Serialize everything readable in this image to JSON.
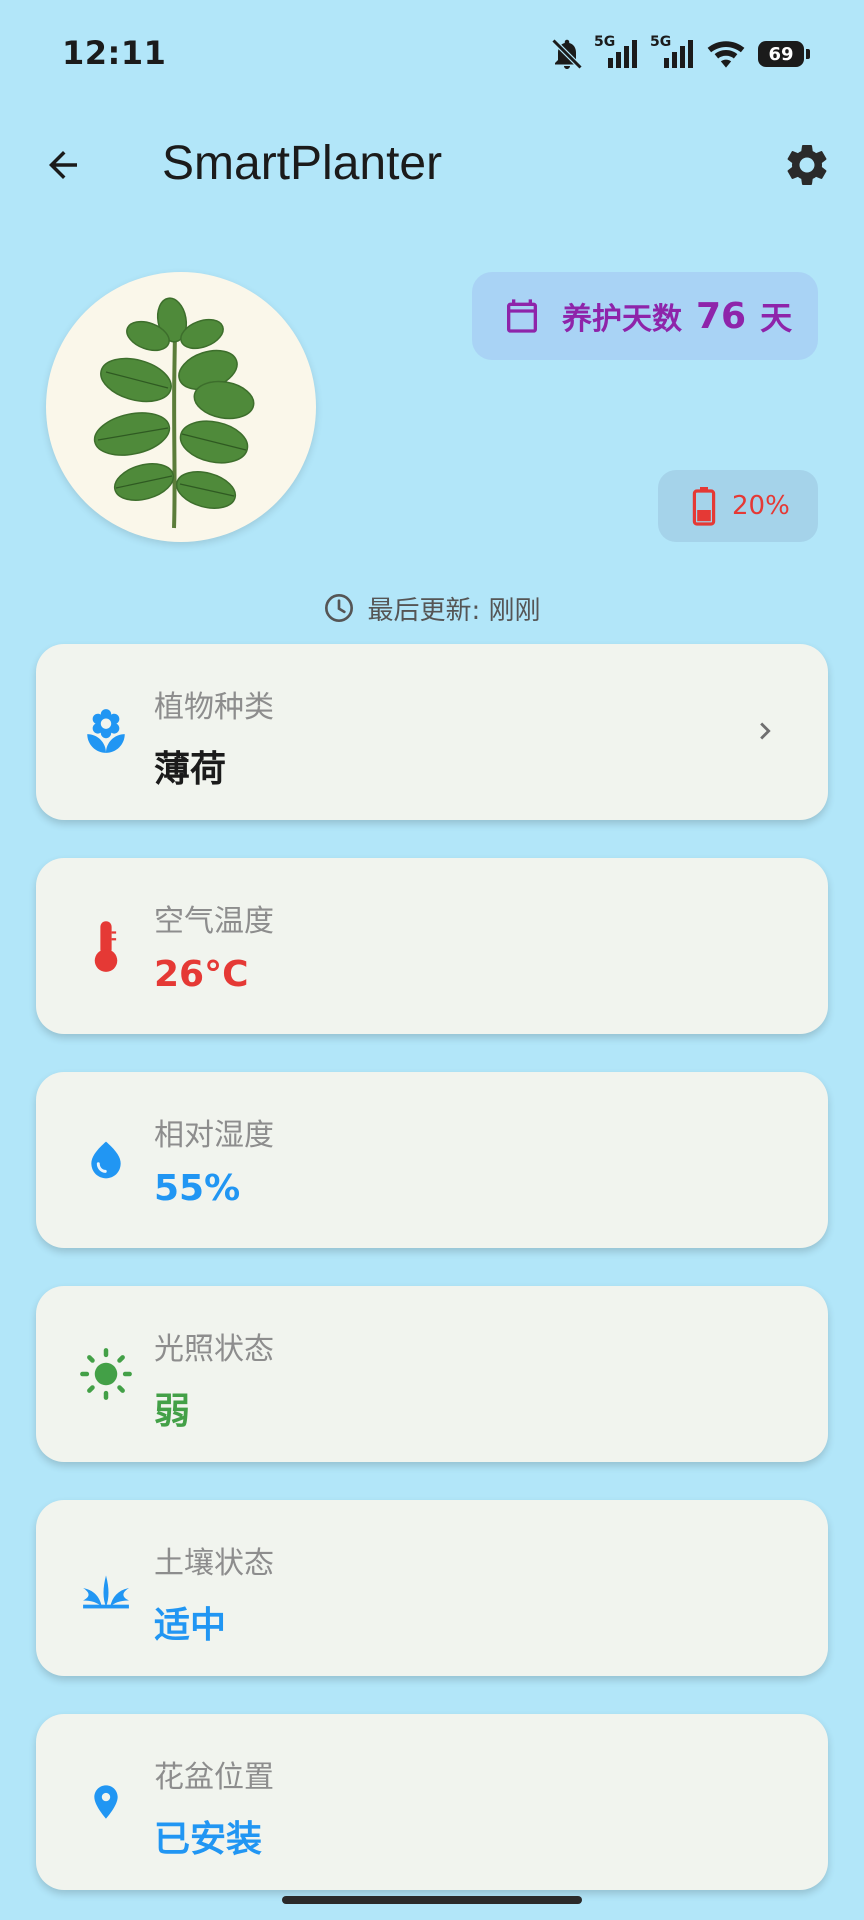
{
  "status_bar": {
    "time": "12:11",
    "network_1": "5G",
    "network_2": "5G",
    "battery": "69"
  },
  "app_bar": {
    "title": "SmartPlanter",
    "back_icon": "arrow-back-icon",
    "settings_icon": "gear-icon"
  },
  "care_days": {
    "label": "养护天数",
    "value": "76",
    "unit": "天",
    "icon": "calendar-icon",
    "color": "#8e24aa"
  },
  "device_battery": {
    "value": "20%",
    "icon": "battery-low-icon",
    "color": "#e53935"
  },
  "last_update": {
    "text": "最后更新: 刚刚",
    "icon": "clock-icon"
  },
  "cards": [
    {
      "label": "植物种类",
      "value": "薄荷",
      "icon": "flower-icon",
      "color": "#1b1b1b",
      "icon_color": "#2196f3"
    },
    {
      "label": "空气温度",
      "value": "26°C",
      "icon": "thermometer-icon",
      "color": "#e53935",
      "icon_color": "#e53935"
    },
    {
      "label": "相对湿度",
      "value": "55%",
      "icon": "water-drop-icon",
      "color": "#2196f3",
      "icon_color": "#2196f3"
    },
    {
      "label": "光照状态",
      "value": "弱",
      "icon": "sun-icon",
      "color": "#43a047",
      "icon_color": "#43a047"
    },
    {
      "label": "土壤状态",
      "value": "适中",
      "icon": "grass-icon",
      "color": "#2196f3",
      "icon_color": "#2196f3"
    },
    {
      "label": "花盆位置",
      "value": "已安装",
      "icon": "location-pin-icon",
      "color": "#2196f3",
      "icon_color": "#2196f3"
    }
  ]
}
